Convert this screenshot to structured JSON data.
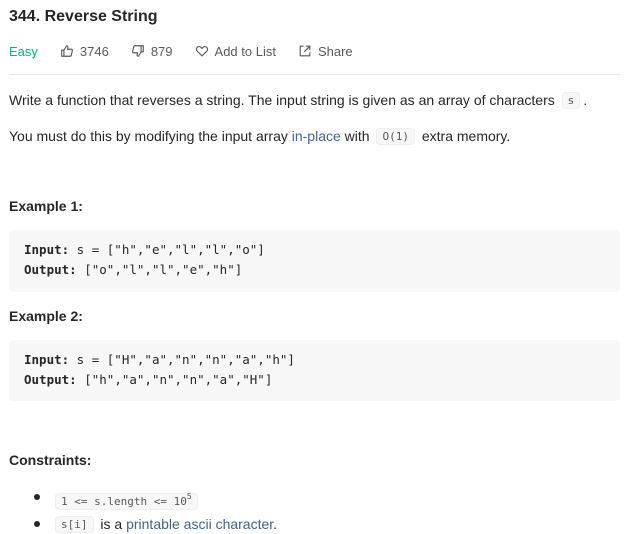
{
  "problem": {
    "title": "344. Reverse String",
    "difficulty": "Easy",
    "likes": "3746",
    "dislikes": "879",
    "add_to_list": "Add to List",
    "share": "Share"
  },
  "description": {
    "p1_text": "Write a function that reverses a string. The input string is given as an array of characters ",
    "p1_code": "s",
    "p1_end": ".",
    "p2_pre": "You must do this by modifying the input array ",
    "p2_link": "in-place",
    "p2_mid": " with ",
    "p2_code": "O(1)",
    "p2_end": " extra memory."
  },
  "examples": [
    {
      "heading": "Example 1:",
      "input_label": "Input:",
      "input_value": " s = [\"h\",\"e\",\"l\",\"l\",\"o\"]",
      "output_label": "Output:",
      "output_value": " [\"o\",\"l\",\"l\",\"e\",\"h\"]"
    },
    {
      "heading": "Example 2:",
      "input_label": "Input:",
      "input_value": " s = [\"H\",\"a\",\"n\",\"n\",\"a\",\"h\"]",
      "output_label": "Output:",
      "output_value": " [\"h\",\"a\",\"n\",\"n\",\"a\",\"H\"]"
    }
  ],
  "constraints": {
    "heading": "Constraints:",
    "c1_code": "1 <= s.length <= 10",
    "c1_sup": "5",
    "c2_code": "s[i]",
    "c2_mid": " is a ",
    "c2_link": "printable ascii character",
    "c2_end": "."
  },
  "colors": {
    "easy": "#00af9b",
    "link": "#42648a",
    "code_bg": "#f7f7f8"
  }
}
